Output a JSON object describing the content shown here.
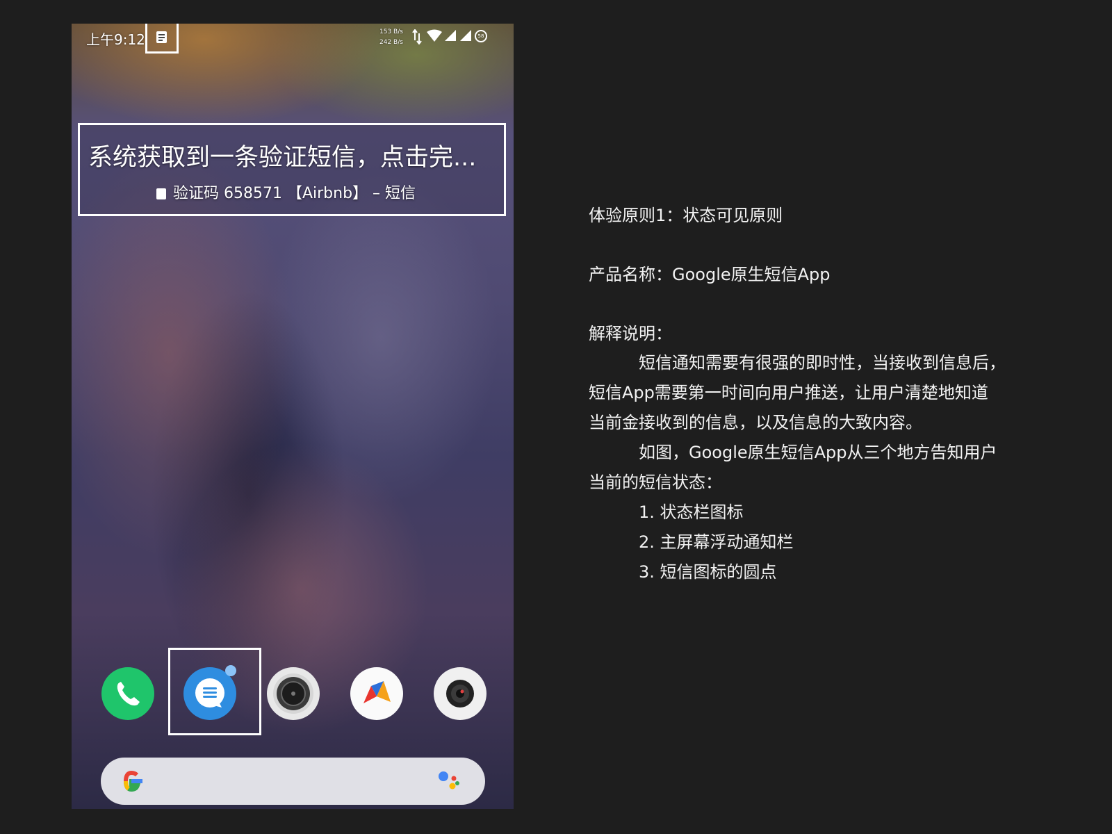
{
  "status_bar": {
    "time": "上午9:12",
    "speed_up": "153 B/s",
    "speed_down": "242 B/s",
    "battery": "58",
    "icons": [
      "message-icon",
      "data-arrows-icon",
      "wifi-icon",
      "signal-icon",
      "signal-icon",
      "battery-icon"
    ]
  },
  "notification": {
    "title": "系统获取到一条验证短信，点击完...",
    "subtitle": "验证码 658571 【Airbnb】 – 短信"
  },
  "dock": {
    "apps": [
      {
        "name": "phone",
        "icon": "phone-icon",
        "color": "#1fc56b"
      },
      {
        "name": "messages",
        "icon": "messages-icon",
        "color": "#2e8de0",
        "unread": true
      },
      {
        "name": "camera",
        "icon": "camera-icon",
        "color": "#e8e8e8"
      },
      {
        "name": "airmail",
        "icon": "airmail-icon",
        "color": "#fafafa"
      },
      {
        "name": "camera-alt",
        "icon": "camera-lens-icon",
        "color": "#f0f0f0"
      }
    ]
  },
  "search": {
    "logo": "google-g-icon",
    "assistant": "google-assistant-icon"
  },
  "explanation": {
    "principle": "体验原则1：状态可见原则",
    "product": "产品名称：Google原生短信App",
    "heading": "解释说明：",
    "para1_line1": "短信通知需要有很强的即时性，当接收到信息后，",
    "para1_line2": "短信App需要第一时间向用户推送，让用户清楚地知道",
    "para1_line3": "当前金接收到的信息，以及信息的大致内容。",
    "para2_line1": "如图，Google原生短信App从三个地方告知用户",
    "para2_line2": "当前的短信状态：",
    "item1": "1. 状态栏图标",
    "item2": "2. 主屏幕浮动通知栏",
    "item3": "3. 短信图标的圆点"
  }
}
